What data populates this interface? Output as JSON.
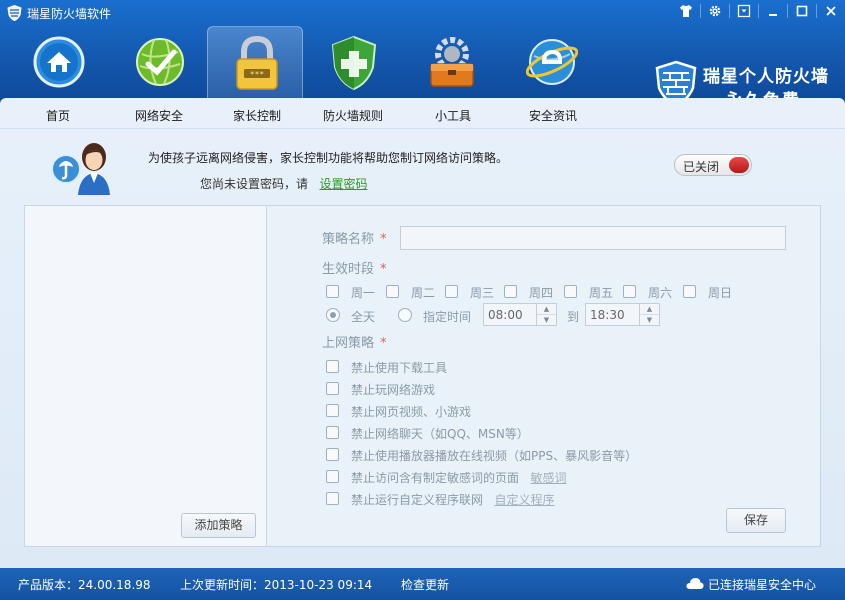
{
  "window": {
    "title": "瑞星防火墙软件"
  },
  "brand": {
    "line1": "瑞星个人防火墙",
    "line2": "永久免费"
  },
  "nav": {
    "items": [
      {
        "label": "首页",
        "icon": "home-icon"
      },
      {
        "label": "网络安全",
        "icon": "globe-check-icon"
      },
      {
        "label": "家长控制",
        "icon": "padlock-icon"
      },
      {
        "label": "防火墙规则",
        "icon": "shield-icon"
      },
      {
        "label": "小工具",
        "icon": "toolbox-icon"
      },
      {
        "label": "安全资讯",
        "icon": "ie-globe-icon"
      }
    ],
    "active_index": 2
  },
  "intro": {
    "description": "为使孩子远离网络侵害，家长控制功能将帮助您制订网络访问策略。",
    "no_password_text": "您尚未设置密码，请",
    "set_password_link": "设置密码",
    "toggle_label": "已关闭"
  },
  "left_panel": {
    "add_button": "添加策略"
  },
  "form": {
    "policy_name_label": "策略名称",
    "policy_name_value": "",
    "period_label": "生效时段",
    "required_mark": "*",
    "days": [
      "周一",
      "周二",
      "周三",
      "周四",
      "周五",
      "周六",
      "周日"
    ],
    "all_day_label": "全天",
    "specified_time_label": "指定时间",
    "time_start": "08:00",
    "time_to_label": "到",
    "time_end": "18:30",
    "internet_policy_label": "上网策略",
    "rules": [
      {
        "label": "禁止使用下载工具",
        "link": ""
      },
      {
        "label": "禁止玩网络游戏",
        "link": ""
      },
      {
        "label": "禁止网页视频、小游戏",
        "link": ""
      },
      {
        "label": "禁止网络聊天（如QQ、MSN等）",
        "link": ""
      },
      {
        "label": "禁止使用播放器播放在线视频（如PPS、暴风影音等）",
        "link": ""
      },
      {
        "label": "禁止访问含有制定敏感词的页面",
        "link": "敏感词"
      },
      {
        "label": "禁止运行自定义程序联网",
        "link": "自定义程序"
      }
    ],
    "save_button": "保存"
  },
  "statusbar": {
    "version": "产品版本：24.00.18.98",
    "last_update": "上次更新时间：2013-10-23 09:14",
    "check_update": "检查更新",
    "cloud_status": "已连接瑞星安全中心"
  },
  "colors": {
    "titlebar": "#1a6fcf",
    "statusbar": "#1352a1",
    "toggle_off": "#c61f1f",
    "link_green": "#2b9a1e"
  }
}
